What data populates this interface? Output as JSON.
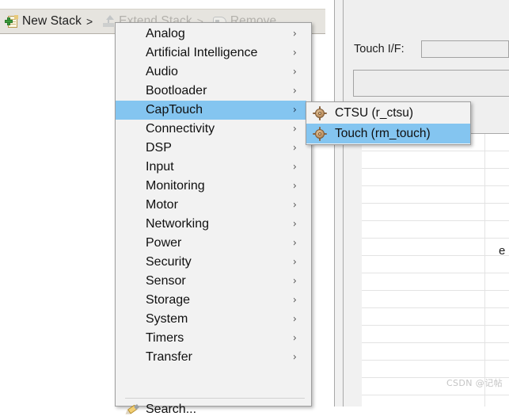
{
  "toolbar": {
    "new_stack_label": "New Stack",
    "new_stack_arrow": ">",
    "extend_stack_label": "Extend Stack",
    "extend_stack_arrow": ">",
    "remove_label": "Remove"
  },
  "properties_panel": {
    "touch_if_label": "Touch I/F:",
    "touch_if_value": "",
    "wide_field_value": ""
  },
  "background_table": {
    "partial_text": "e"
  },
  "context_menu": {
    "items": [
      {
        "label": "Analog",
        "chevron": "›",
        "selected": false
      },
      {
        "label": "Artificial Intelligence",
        "chevron": "›",
        "selected": false
      },
      {
        "label": "Audio",
        "chevron": "›",
        "selected": false
      },
      {
        "label": "Bootloader",
        "chevron": "›",
        "selected": false
      },
      {
        "label": "CapTouch",
        "chevron": "›",
        "selected": true
      },
      {
        "label": "Connectivity",
        "chevron": "›",
        "selected": false
      },
      {
        "label": "DSP",
        "chevron": "›",
        "selected": false
      },
      {
        "label": "Input",
        "chevron": "›",
        "selected": false
      },
      {
        "label": "Monitoring",
        "chevron": "›",
        "selected": false
      },
      {
        "label": "Motor",
        "chevron": "›",
        "selected": false
      },
      {
        "label": "Networking",
        "chevron": "›",
        "selected": false
      },
      {
        "label": "Power",
        "chevron": "›",
        "selected": false
      },
      {
        "label": "Security",
        "chevron": "›",
        "selected": false
      },
      {
        "label": "Sensor",
        "chevron": "›",
        "selected": false
      },
      {
        "label": "Storage",
        "chevron": "›",
        "selected": false
      },
      {
        "label": "System",
        "chevron": "›",
        "selected": false
      },
      {
        "label": "Timers",
        "chevron": "›",
        "selected": false
      },
      {
        "label": "Transfer",
        "chevron": "›",
        "selected": false
      }
    ],
    "search_label": "Search..."
  },
  "submenu": {
    "parent": "CapTouch",
    "items": [
      {
        "label": "CTSU (r_ctsu)",
        "selected": false
      },
      {
        "label": "Touch (rm_touch)",
        "selected": true
      }
    ]
  },
  "watermark": "CSDN @记帖",
  "colors": {
    "selection_blue": "#84c5f0",
    "menu_background": "#f2f2f2",
    "toolbar_background": "#e6e4df",
    "panel_background": "#efefef"
  }
}
